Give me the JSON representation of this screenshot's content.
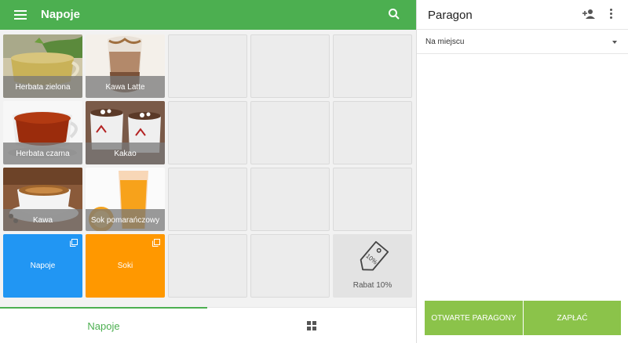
{
  "colors": {
    "primary": "#4caf50",
    "accent": "#8bc34a",
    "napoje_tile": "#2196f3",
    "soki_tile": "#ff9800"
  },
  "appbar": {
    "title": "Napoje",
    "menu_icon": "menu-icon",
    "search_icon": "search-icon"
  },
  "products": [
    {
      "label": "Herbata zielona"
    },
    {
      "label": "Kawa Latte"
    },
    {
      "label": "Herbata czarna"
    },
    {
      "label": "Kakao"
    },
    {
      "label": "Kawa"
    },
    {
      "label": "Sok pomarańczowy"
    }
  ],
  "categories": [
    {
      "label": "Napoje"
    },
    {
      "label": "Soki"
    }
  ],
  "discount": {
    "label": "Rabat 10%",
    "tag_text": "10%"
  },
  "bottom_nav": {
    "tab_label": "Napoje",
    "grid_icon": "grid-icon"
  },
  "receipt": {
    "title": "Paragon",
    "add_customer_icon": "person-add-icon",
    "more_icon": "more-vert-icon",
    "order_type": "Na miejscu",
    "open_button": "OTWARTE PARAGONY",
    "pay_button": "ZAPŁAĆ"
  }
}
